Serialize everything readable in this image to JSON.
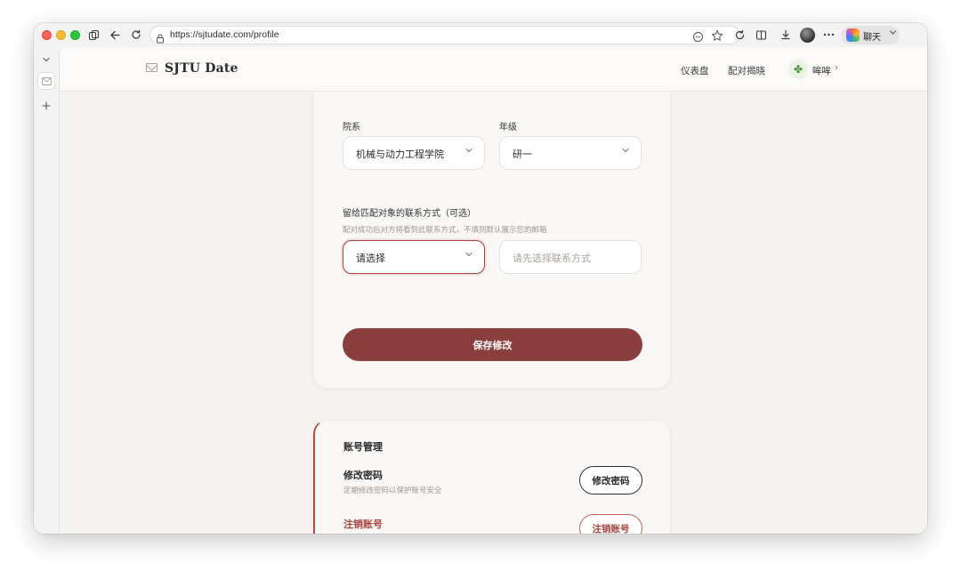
{
  "browser": {
    "url": "https://sjtudate.com/profile",
    "copilot_label": "聊天"
  },
  "header": {
    "brand": "SJTU Date",
    "nav": [
      "仪表盘",
      "配对揭晓"
    ],
    "user_name": "哞哞"
  },
  "profile_form": {
    "department_label": "院系",
    "department_value": "机械与动力工程学院",
    "grade_label": "年级",
    "grade_value": "研一",
    "contact_label": "留给匹配对象的联系方式（可选）",
    "contact_hint": "配对成功后对方将看到此联系方式，不填则默认展示您的邮箱",
    "contact_type_value": "请选择",
    "contact_value_placeholder": "请先选择联系方式",
    "save_label": "保存修改"
  },
  "account": {
    "section_title": "账号管理",
    "change_password_title": "修改密码",
    "change_password_desc": "定期修改密码以保护账号安全",
    "change_password_button": "修改密码",
    "delete_account_title": "注销账号",
    "delete_account_button": "注销账号"
  },
  "colors": {
    "accent": "#8a3f3c",
    "danger": "#a84340",
    "page_bg": "#f6f4f1"
  }
}
